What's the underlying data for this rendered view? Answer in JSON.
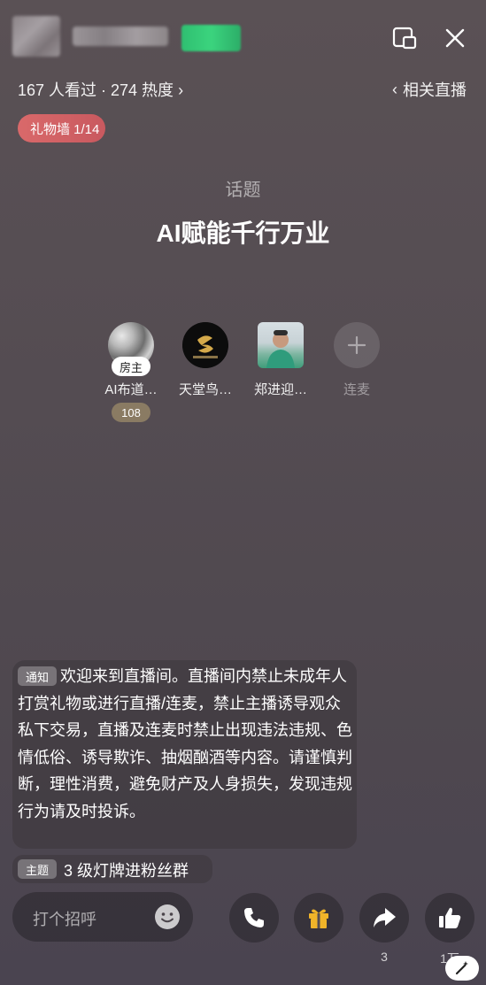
{
  "header": {
    "stats_text": "167 人看过 · 274 热度 ›",
    "related_label": "相关直播"
  },
  "gift_wall": {
    "label": "礼物墙 1/14"
  },
  "topic": {
    "label": "话题",
    "title": "AI赋能千行万业"
  },
  "seats": [
    {
      "name": "AI布道…",
      "tag": "房主",
      "count": "108"
    },
    {
      "name": "天堂鸟…"
    },
    {
      "name": "郑进迎…"
    },
    {
      "name": "连麦"
    }
  ],
  "notice": {
    "tag": "通知",
    "text": "欢迎来到直播间。直播间内禁止未成年人打赏礼物或进行直播/连麦，禁止主播诱导观众私下交易，直播及连麦时禁止出现违法违规、色情低俗、诱导欺诈、抽烟酗酒等内容。请谨慎判断，理性消费，避免财产及人身损失，发现违规行为请及时投诉。"
  },
  "theme": {
    "tag": "主题",
    "text": "3 级灯牌进粉丝群"
  },
  "bottom_bar": {
    "comment_placeholder": "打个招呼",
    "share_count": "3",
    "like_count": "1万"
  },
  "icons": {
    "close": "close-icon",
    "float": "float-window-icon",
    "emoji": "emoji-icon",
    "phone": "phone-icon",
    "gift": "gift-icon",
    "share": "share-icon",
    "like": "thumbs-up-icon",
    "plus": "plus-icon",
    "magic": "magic-wand-icon"
  },
  "colors": {
    "gift_wall_bg": "#d9696a",
    "count_badge_bg": "#8a7b63",
    "gift_icon": "#f0b429"
  }
}
